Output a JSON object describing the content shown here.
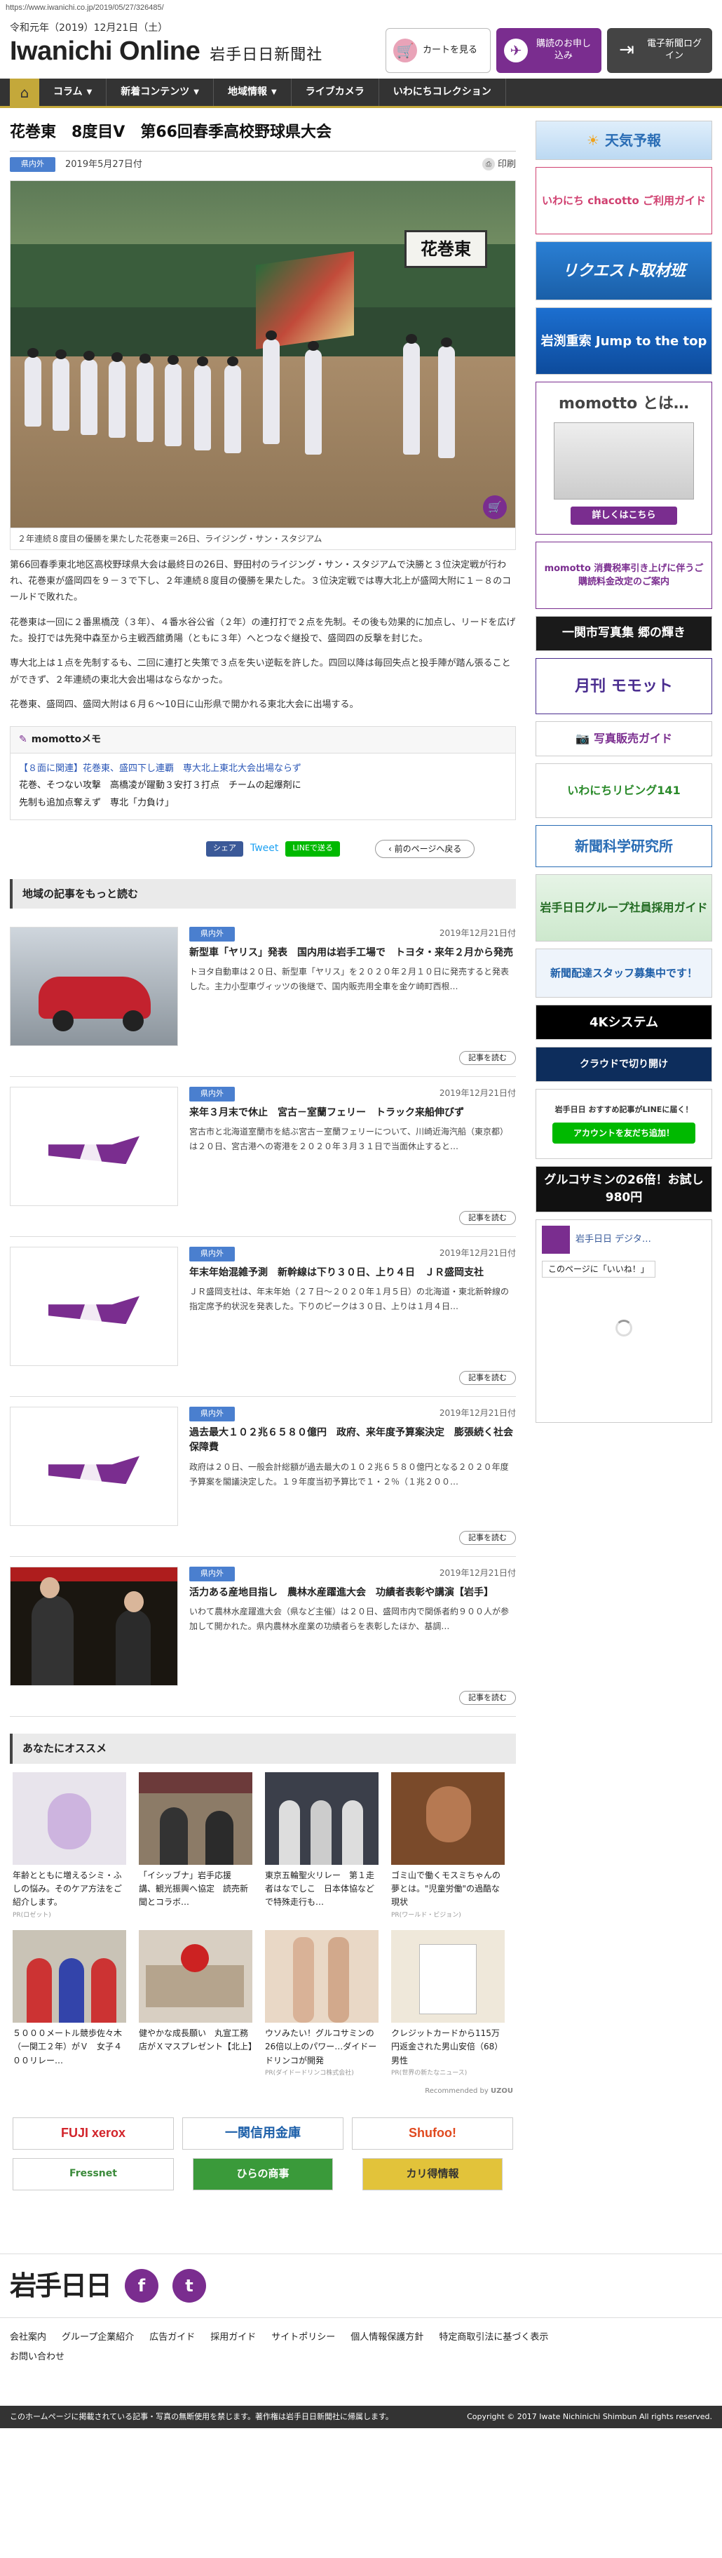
{
  "url": "https://www.iwanichi.co.jp/2019/05/27/326485/",
  "header": {
    "date": "令和元年（2019）12月21日（土）",
    "logo": "Iwanichi Online",
    "logo_sub": "岩手日日新聞社",
    "buttons": [
      {
        "label": "カートを見る",
        "icon": "cart-icon"
      },
      {
        "label": "購読のお申し込み",
        "icon": "bird-icon"
      },
      {
        "label": "電子新聞ログイン",
        "icon": "login-icon"
      }
    ]
  },
  "nav": {
    "items": [
      {
        "label": "コラム",
        "dropdown": true
      },
      {
        "label": "新着コンテンツ",
        "dropdown": true
      },
      {
        "label": "地域情報",
        "dropdown": true
      },
      {
        "label": "ライブカメラ",
        "dropdown": false
      },
      {
        "label": "いわにちコレクション",
        "dropdown": false
      }
    ]
  },
  "article": {
    "title": "花巻東　8度目V　第66回春季高校野球県大会",
    "tag": "県内外",
    "date": "2019年5月27日付",
    "print": "印刷",
    "photo_sign": "花巻東",
    "caption": "２年連続８度目の優勝を果たした花巻東＝26日、ライジング・サン・スタジアム",
    "paragraphs": [
      "第66回春季東北地区高校野球県大会は最終日の26日、野田村のライジング・サン・スタジアムで決勝と３位決定戦が行われ、花巻東が盛岡四を９－３で下し、２年連続８度目の優勝を果たした。３位決定戦では専大北上が盛岡大附に１－８のコールドで敗れた。",
      "花巻東は一回に２番黒橋茂（３年）、４番水谷公省（２年）の連打打で２点を先制。その後も効果的に加点し、リードを広げた。投打では先発中森至から主戦西舘勇陽（ともに３年）へとつなぐ継投で、盛岡四の反撃を封じた。",
      "専大北上は１点を先制するも、二回に連打と失策で３点を失い逆転を許した。四回以降は毎回失点と投手陣が踏ん張ることができず、２年連続の東北大会出場はならなかった。",
      "花巻東、盛岡四、盛岡大附は６月６～10日に山形県で開かれる東北大会に出場する。"
    ],
    "memo_title": "momottoメモ",
    "memo_lines": [
      "【８面に関連】花巻東、盛四下し連覇　専大北上東北大会出場ならず",
      "花巻、そつない攻撃　高橋凌が躍動３安打３打点　チームの起爆剤に",
      "先制も追加点奪えず　専北「力負け」"
    ],
    "share": {
      "fb": "シェア",
      "tw": "Tweet",
      "line": "LINEで送る",
      "back": "前のページへ戻る"
    }
  },
  "local": {
    "heading": "地域の記事をもっと読む",
    "cards": [
      {
        "tag": "県内外",
        "date": "2019年12月21日付",
        "title": "新型車「ヤリス」発表　国内用は岩手工場で　トヨタ・来年２月から発売",
        "desc": "トヨタ自動車は２０日、新型車「ヤリス」を２０２０年２月１０日に発売すると発表した。主力小型車ヴィッツの後継で、国内販売用全車を金ケ崎町西根…",
        "more": "記事を読む"
      },
      {
        "tag": "県内外",
        "date": "2019年12月21日付",
        "title": "来年３月末で休止　宮古－室蘭フェリー　トラック来船伸びず",
        "desc": "宮古市と北海道室蘭市を結ぶ宮古－室蘭フェリーについて、川崎近海汽船（東京都）は２０日、宮古港への寄港を２０２０年３月３１日で当面休止すると…",
        "more": "記事を読む"
      },
      {
        "tag": "県内外",
        "date": "2019年12月21日付",
        "title": "年末年始混雑予測　新幹線は下り３０日、上り４日　ＪＲ盛岡支社",
        "desc": "ＪＲ盛岡支社は、年末年始（２７日～２０２０年１月５日）の北海道・東北新幹線の指定席予約状況を発表した。下りのピークは３０日、上りは１月４日…",
        "more": "記事を読む"
      },
      {
        "tag": "県内外",
        "date": "2019年12月21日付",
        "title": "過去最大１０２兆６５８０億円　政府、来年度予算案決定　膨張続く社会保障費",
        "desc": "政府は２０日、一般会計総額が過去最大の１０２兆６５８０億円となる２０２０年度予算案を閣議決定した。１９年度当初予算比で１・２％（１兆２００…",
        "more": "記事を読む"
      },
      {
        "tag": "県内外",
        "date": "2019年12月21日付",
        "title": "活力ある産地目指し　農林水産躍進大会　功績者表彰や講演【岩手】",
        "desc": "いわて農林水産躍進大会（県など主催）は２０日、盛岡市内で関係者約９００人が参加して開かれた。県内農林水産業の功績者らを表彰したほか、基調…",
        "more": "記事を読む"
      }
    ]
  },
  "recommend": {
    "heading": "あなたにオススメ",
    "items": [
      {
        "text": "年齢とともに増えるシミ・ふしの悩み。そのケア方法をご紹介します。",
        "pr": "PR(ロゼット)"
      },
      {
        "text": "「イシッブナ」岩手応援　講、観光振興へ協定　読売新聞とコラボ…",
        "pr": ""
      },
      {
        "text": "東京五輪聖火リレー　第１走者はなでしこ　日本体協などで特殊走行も…",
        "pr": ""
      },
      {
        "text": "ゴミ山で働くモスミちゃんの夢とは。\"児童労働\"の過酷な現状",
        "pr": "PR(ワールド・ビジョン)"
      },
      {
        "text": "５０００メートル競歩佐々木（一関工２年）がＶ　女子４００リレー…",
        "pr": ""
      },
      {
        "text": "健やかな成長願い　丸宣工務店がＸマスプレゼント【北上】",
        "pr": ""
      },
      {
        "text": "ウソみたい！グルコサミンの26倍以上のパワー…ダイドードリンコが開発",
        "pr": "PR(ダイドードリンコ株式会社)"
      },
      {
        "text": "クレジットカードから115万円返金された男山安倍（68）男性",
        "pr": "PR(世界の新たなニュース)"
      }
    ],
    "by": "Recommended by"
  },
  "sponsors": [
    "FUJI xerox",
    "一関信用金庫",
    "Shufoo!",
    "Fressnet",
    "ひらの商事",
    "カリ得情報"
  ],
  "sidebar": [
    {
      "text": "天気予報"
    },
    {
      "text": "いわにち chacotto ご利用ガイド"
    },
    {
      "text": "リクエスト取材班"
    },
    {
      "text": "岩渕重索 Jump to the top"
    },
    {
      "text": "momotto とは…"
    },
    {
      "text": "詳しくはこちら"
    },
    {
      "text": "momotto 消費税率引き上げに伴うご購読料金改定のご案内"
    },
    {
      "text": "一関市写真集 郷の輝き"
    },
    {
      "text": "月刊 モモット"
    },
    {
      "text": "写真販売ガイド"
    },
    {
      "text": "いわにちリビング141"
    },
    {
      "text": "新聞科学研究所"
    },
    {
      "text": "岩手日日グループ社員採用ガイド"
    },
    {
      "text": "新聞配達スタッフ募集中です！"
    },
    {
      "text": "4Kシステム"
    },
    {
      "text": "クラウドで切り開け"
    },
    {
      "text": "岩手日日 おすすめ記事がLINEに届く！"
    },
    {
      "text": "アカウントを友だち追加！"
    },
    {
      "text": "グルコサミンの26倍！お試し980円"
    },
    {
      "text": "岩手日日 デジタ…"
    },
    {
      "text": "このページに「いいね！」"
    }
  ],
  "footer": {
    "logo": "岩手日日",
    "links": [
      "会社案内",
      "グループ企業紹介",
      "広告ガイド",
      "採用ガイド",
      "サイトポリシー",
      "個人情報保護方針",
      "特定商取引法に基づく表示",
      "お問い合わせ"
    ],
    "notice": "このホームページに掲載されている記事・写真の無断使用を禁じます。著作権は岩手日日新聞社に帰属します。",
    "copyright": "Copyright © 2017 Iwate Nichinichi Shimbun All rights reserved."
  }
}
